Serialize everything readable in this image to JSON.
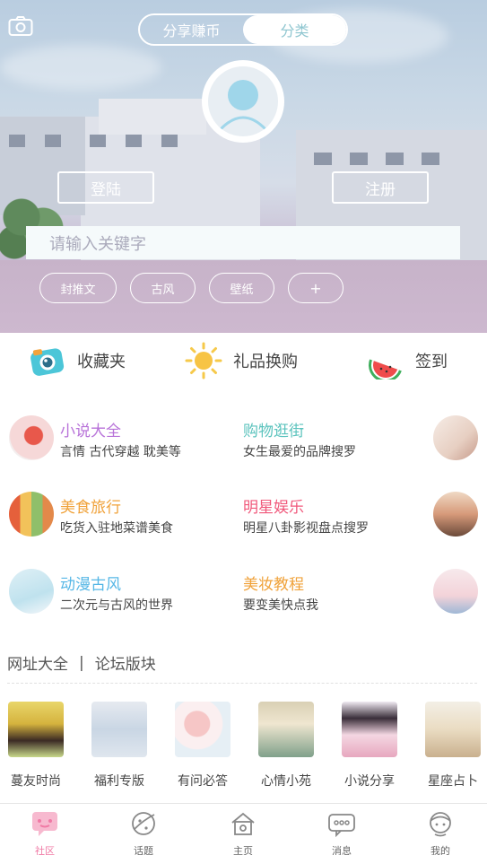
{
  "header": {
    "segment": [
      {
        "label": "分享赚币",
        "active": false
      },
      {
        "label": "分类",
        "active": true
      }
    ]
  },
  "auth": {
    "login_label": "登陆",
    "register_label": "注册"
  },
  "search": {
    "placeholder": "请输入关键字"
  },
  "tags": [
    "封推文",
    "古风",
    "壁纸",
    "+"
  ],
  "quick_actions": [
    {
      "label": "收藏夹",
      "icon": "camera-icon"
    },
    {
      "label": "礼品换购",
      "icon": "sun-icon"
    },
    {
      "label": "签到",
      "icon": "watermelon-icon"
    }
  ],
  "categories": [
    {
      "title": "小说大全",
      "sub": "言情 古代穿越 耽美等",
      "color": "#b873d9"
    },
    {
      "title": "购物逛街",
      "sub": "女生最爱的品牌搜罗",
      "color": "#5bc3bd"
    },
    {
      "title": "美食旅行",
      "sub": "吃货入驻地菜谱美食",
      "color": "#f0a23a"
    },
    {
      "title": "明星娱乐",
      "sub": "明星八卦影视盘点搜罗",
      "color": "#f0577a"
    },
    {
      "title": "动漫古风",
      "sub": "二次元与古风的世界",
      "color": "#56b7e6"
    },
    {
      "title": "美妆教程",
      "sub": "要变美快点我",
      "color": "#f0a23a"
    }
  ],
  "section": {
    "left": "网址大全",
    "separator": "|",
    "right": "论坛版块"
  },
  "boards": [
    "蔓友时尚",
    "福利专版",
    "有问必答",
    "心情小苑",
    "小说分享",
    "星座占卜"
  ],
  "tabbar": [
    {
      "label": "社区",
      "active": true,
      "icon": "community-icon"
    },
    {
      "label": "话题",
      "active": false,
      "icon": "topic-icon"
    },
    {
      "label": "主页",
      "active": false,
      "icon": "home-icon"
    },
    {
      "label": "消息",
      "active": false,
      "icon": "message-icon"
    },
    {
      "label": "我的",
      "active": false,
      "icon": "profile-icon"
    }
  ],
  "colors": {
    "accent": "#f07aa5",
    "segment_active_text": "#8fc6d0"
  }
}
